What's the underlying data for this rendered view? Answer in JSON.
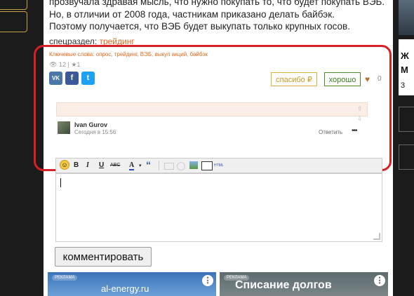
{
  "article": {
    "line1": "прозвучала здравая мысль, что нужно покупать то, что будет покупать ВЭБ.",
    "line2": "Но, в отличии от 2008 года, частникам приказано делать байбэк.",
    "line3": "Поэтому получается, что ВЭБ будет выкупать только крупных госов.",
    "subsection_label": "спецраздел:",
    "subsection_link": "трейдинг"
  },
  "post_meta": {
    "keywords": "Ключевые слова: опрос, трейдинг, ВЭБ, выкуп акций, байбэк",
    "views": "12",
    "favorites": "1",
    "share": {
      "vk": "VK",
      "facebook": "f",
      "twitter": "t"
    },
    "thanks_label": "спасибо ₽",
    "good_label": "хорошо",
    "likes": "0"
  },
  "comment": {
    "author": "Ivan Gurov",
    "time": "Сегодня в 15:56",
    "reply_label": "Ответить",
    "more": "•••"
  },
  "editor_toolbar": {
    "smile": "☺",
    "bold": "B",
    "italic": "I",
    "underline": "U",
    "strike": "ABC",
    "font_color": "A",
    "quote": "“",
    "html": "HTML"
  },
  "submit_label": "комментировать",
  "ads": [
    {
      "badge": "РЕКЛАМА",
      "title": "al-energy.ru"
    },
    {
      "badge": "РЕКЛАМА",
      "title": "Списание долгов"
    }
  ],
  "right_rail": {
    "letter1": "Ж",
    "letter2": "М",
    "num": "3"
  },
  "colors": {
    "accent": "#e2691f",
    "frame": "#d91f26",
    "thanks": "#d9b23c",
    "good": "#4f8a2f"
  }
}
